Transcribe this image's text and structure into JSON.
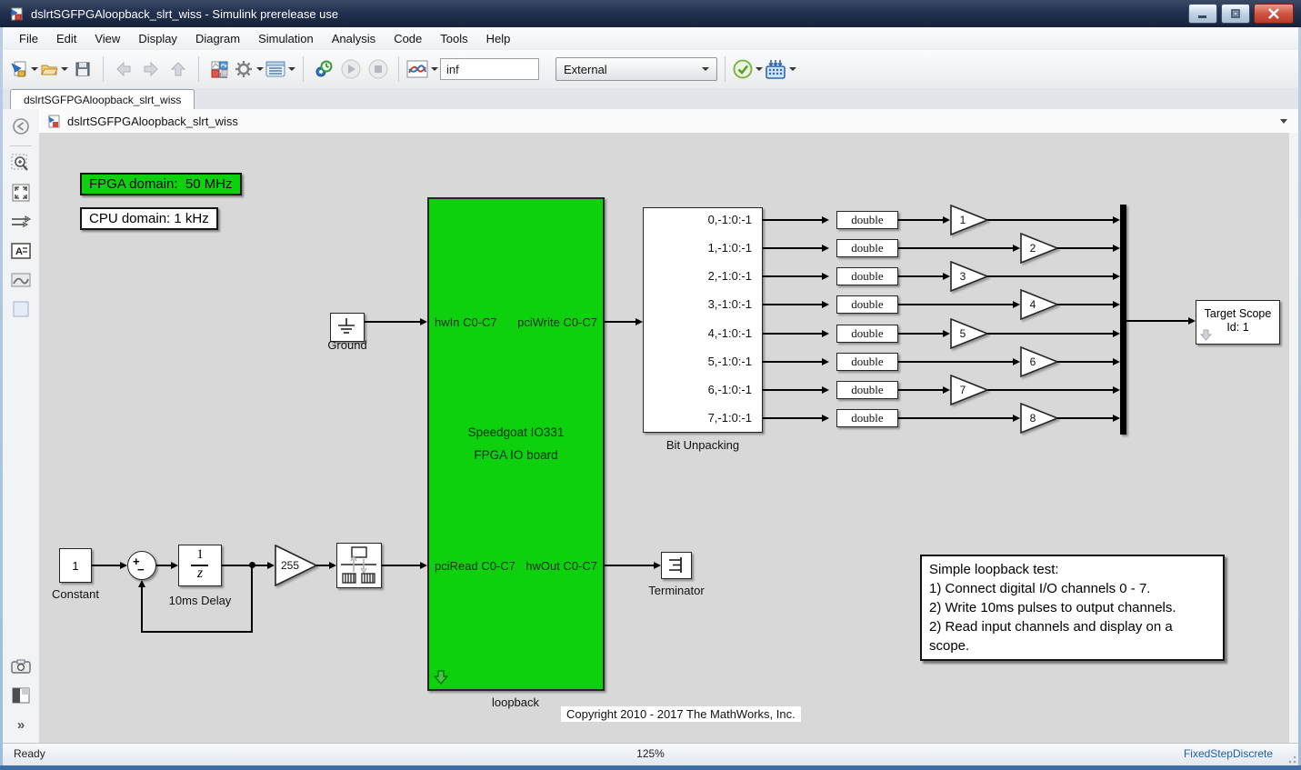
{
  "window": {
    "title": "dslrtSGFPGAloopback_slrt_wiss - Simulink prerelease use"
  },
  "menu": {
    "items": [
      "File",
      "Edit",
      "View",
      "Display",
      "Diagram",
      "Simulation",
      "Analysis",
      "Code",
      "Tools",
      "Help"
    ]
  },
  "toolbar": {
    "stop_time_value": "inf",
    "mode_value": "External"
  },
  "tabs": {
    "active_label": "dslrtSGFPGAloopback_slrt_wiss"
  },
  "breadcrumb": {
    "model_name": "dslrtSGFPGAloopback_slrt_wiss"
  },
  "palette": {
    "more_glyph": "»"
  },
  "canvas": {
    "fpga_domain_label": "FPGA domain:  50 MHz",
    "cpu_domain_label": "CPU domain: 1 kHz",
    "ground": {
      "label": "Ground"
    },
    "loopback": {
      "port_hwin": "hwIn C0-C7",
      "port_pciwrite": "pciWrite C0-C7",
      "port_pciread": "pciRead C0-C7",
      "port_hwout": "hwOut C0-C7",
      "line1": "Speedgoat IO331",
      "line2": "FPGA IO board",
      "label": "loopback"
    },
    "bit_unpacking": {
      "label": "Bit Unpacking",
      "ports": [
        "0,-1:0:-1",
        "1,-1:0:-1",
        "2,-1:0:-1",
        "3,-1:0:-1",
        "4,-1:0:-1",
        "5,-1:0:-1",
        "6,-1:0:-1",
        "7,-1:0:-1"
      ]
    },
    "double_blocks": [
      "double",
      "double",
      "double",
      "double",
      "double",
      "double",
      "double",
      "double"
    ],
    "gains": [
      "1",
      "2",
      "3",
      "4",
      "5",
      "6",
      "7",
      "8"
    ],
    "constant": {
      "value": "1",
      "label": "Constant"
    },
    "sum": {
      "plus": "+",
      "minus": "−"
    },
    "delay": {
      "num": "1",
      "den": "z",
      "label": "10ms Delay"
    },
    "gain255": {
      "value": "255"
    },
    "terminator": {
      "label": "Terminator"
    },
    "target_scope": {
      "line1": "Target Scope",
      "line2": "Id: 1"
    },
    "note": {
      "lines": [
        "Simple loopback test:",
        "1) Connect digital I/O channels 0 - 7.",
        "2) Write 10ms pulses to output channels.",
        "2) Read input channels and display on a scope."
      ]
    },
    "copyright": "Copyright 2010 - 2017 The MathWorks, Inc."
  },
  "statusbar": {
    "ready": "Ready",
    "zoom": "125%",
    "solver": "FixedStepDiscrete"
  },
  "colors": {
    "block_green": "#0dd10d",
    "solver_text": "#1d5fae"
  }
}
